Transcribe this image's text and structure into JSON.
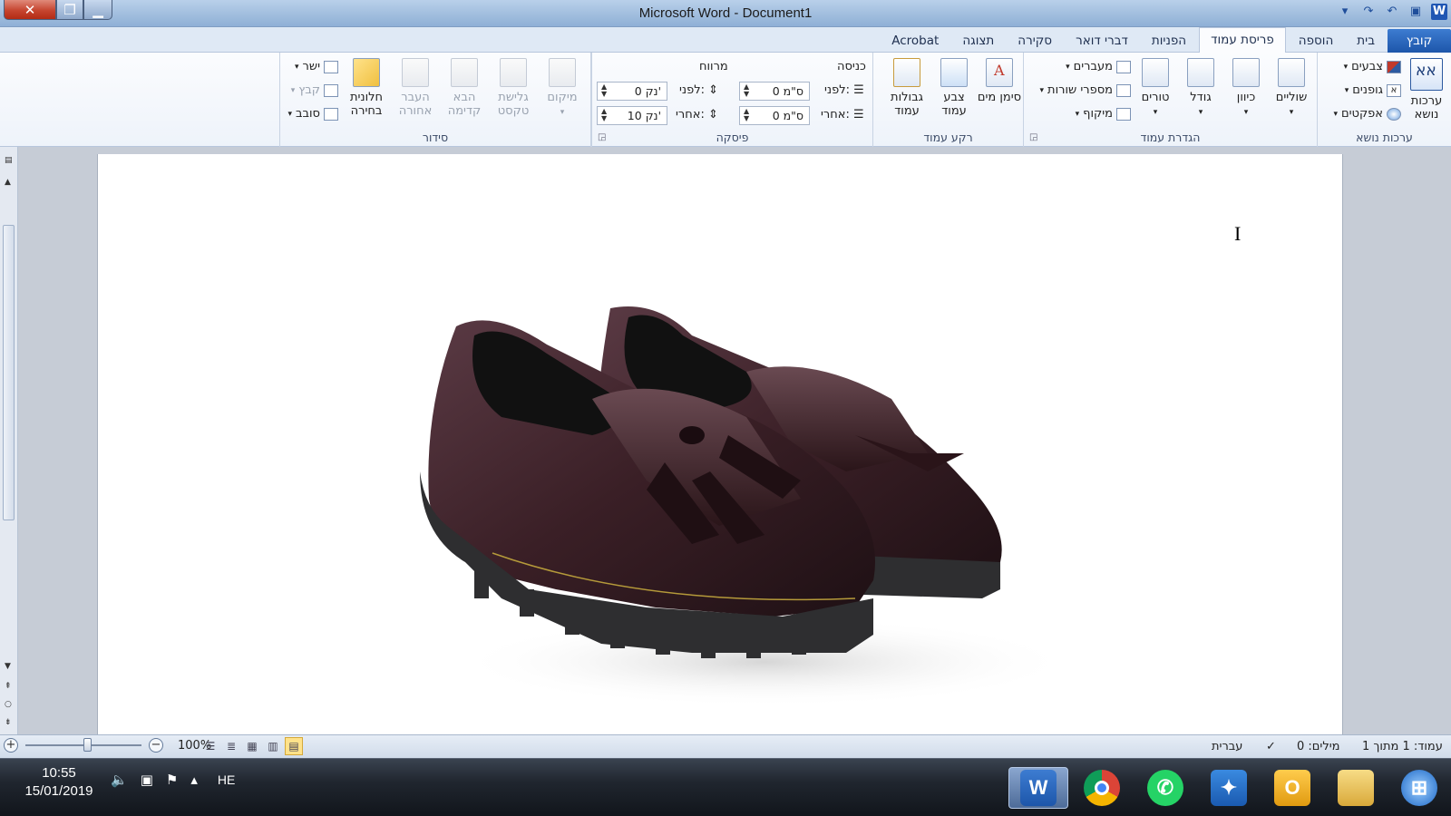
{
  "window": {
    "title": "Microsoft Word - Document1"
  },
  "tabs": [
    {
      "label": "קובץ",
      "file": true
    },
    {
      "label": "בית"
    },
    {
      "label": "הוספה"
    },
    {
      "label": "פריסת עמוד",
      "active": true
    },
    {
      "label": "הפניות"
    },
    {
      "label": "דברי דואר"
    },
    {
      "label": "סקירה"
    },
    {
      "label": "תצוגה"
    },
    {
      "label": "Acrobat"
    }
  ],
  "ribbon": {
    "themes": {
      "group_label": "ערכות נושא",
      "themes_btn": "ערכות נושא",
      "colors": "צבעים",
      "fonts": "גופנים",
      "effects": "אפקטים"
    },
    "page_setup": {
      "group_label": "הגדרת עמוד",
      "margins": "שוליים",
      "orientation": "כיוון",
      "size": "גודל",
      "columns": "טורים",
      "breaks": "מעברים",
      "line_numbers": "מספרי שורות",
      "hyphenation": "מיקוף"
    },
    "page_background": {
      "group_label": "רקע עמוד",
      "watermark": "סימן מים",
      "page_color": "צבע עמוד",
      "page_borders": "גבולות עמוד"
    },
    "paragraph": {
      "group_label": "פיסקה",
      "indent_title": "כניסה",
      "indent_before_label": "לפני:",
      "indent_before_value": "0 ס\"מ",
      "indent_after_label": "אחרי:",
      "indent_after_value": "0 ס\"מ",
      "spacing_title": "מרווח",
      "spacing_before_label": "לפני:",
      "spacing_before_value": "0 נק'",
      "spacing_after_label": "אחרי:",
      "spacing_after_value": "10 נק'"
    },
    "arrange": {
      "group_label": "סידור",
      "position": "מיקום",
      "wrap_text": "גלישת טקסט",
      "bring_forward": "הבא קדימה",
      "send_backward": "העבר אחורה",
      "selection_pane": "חלונית בחירה",
      "align": "ישר",
      "group": "קבץ",
      "rotate": "סובב"
    }
  },
  "status": {
    "page": "עמוד: 1 מתוך 1",
    "words": "מילים: 0",
    "language": "עברית",
    "zoom": "100%"
  },
  "taskbar": {
    "time": "10:55",
    "date": "15/01/2019",
    "lang": "HE",
    "apps": [
      "word-app",
      "chrome-app",
      "whatsapp-app",
      "tools-app",
      "outlook-app",
      "explorer-app",
      "start-button"
    ]
  },
  "colors": {
    "accent": "#1d56aa",
    "shoe": "#3a1f26",
    "sole": "#2e2e30"
  }
}
